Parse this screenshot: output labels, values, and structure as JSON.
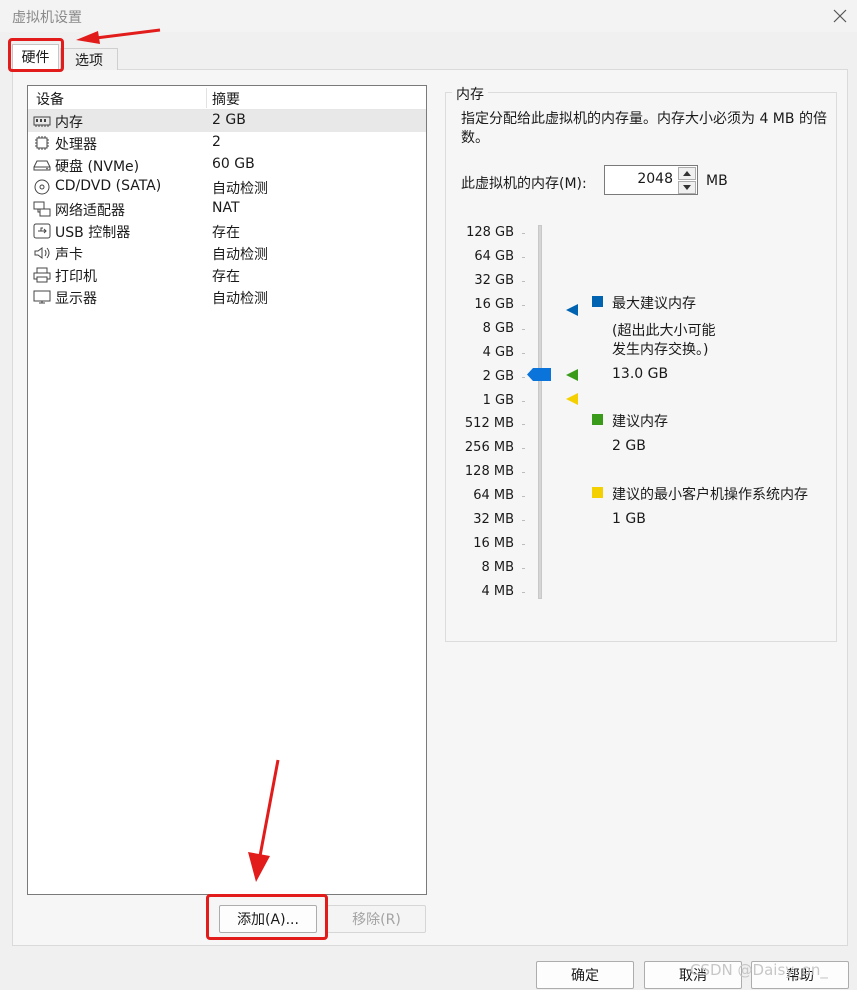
{
  "window": {
    "title": "虚拟机设置"
  },
  "tabs": [
    {
      "label": "硬件"
    },
    {
      "label": "选项"
    }
  ],
  "device_list": {
    "columns": [
      "设备",
      "摘要"
    ],
    "rows": [
      {
        "name": "内存",
        "summary": "2 GB",
        "icon": "memory-icon"
      },
      {
        "name": "处理器",
        "summary": "2",
        "icon": "processor-icon"
      },
      {
        "name": "硬盘 (NVMe)",
        "summary": "60 GB",
        "icon": "harddisk-icon"
      },
      {
        "name": "CD/DVD (SATA)",
        "summary": "自动检测",
        "icon": "cd-dvd-icon"
      },
      {
        "name": "网络适配器",
        "summary": "NAT",
        "icon": "network-adapter-icon"
      },
      {
        "name": "USB 控制器",
        "summary": "存在",
        "icon": "usb-icon"
      },
      {
        "name": "声卡",
        "summary": "自动检测",
        "icon": "sound-card-icon"
      },
      {
        "name": "打印机",
        "summary": "存在",
        "icon": "printer-icon"
      },
      {
        "name": "显示器",
        "summary": "自动检测",
        "icon": "display-icon"
      }
    ]
  },
  "memory": {
    "group_title": "内存",
    "description": "指定分配给此虚拟机的内存量。内存大小必须为 4 MB 的倍数。",
    "field_label": "此虚拟机的内存(M):",
    "value": "2048",
    "unit": "MB",
    "scale_labels": [
      "128 GB",
      "64 GB",
      "32 GB",
      "16 GB",
      "8 GB",
      "4 GB",
      "2 GB",
      "1 GB",
      "512 MB",
      "256 MB",
      "128 MB",
      "64 MB",
      "32 MB",
      "16 MB",
      "8 MB",
      "4 MB"
    ],
    "max_recommended": {
      "title": "最大建议内存",
      "note_line1": "(超出此大小可能",
      "note_line2": "发生内存交换。)",
      "value": "13.0 GB",
      "color": "#0063b1"
    },
    "recommended": {
      "title": "建议内存",
      "value": "2 GB",
      "color": "#3a9a1a"
    },
    "min_guest": {
      "title": "建议的最小客户机操作系统内存",
      "value": "1 GB",
      "color": "#f5d000"
    },
    "slider_color": "#0a74da"
  },
  "buttons": {
    "add": "添加(A)...",
    "remove": "移除(R)",
    "ok": "确定",
    "cancel": "取消",
    "help": "帮助"
  },
  "watermark": "CSDN @Daisy_on_",
  "annotation_color": "#e21b1b"
}
